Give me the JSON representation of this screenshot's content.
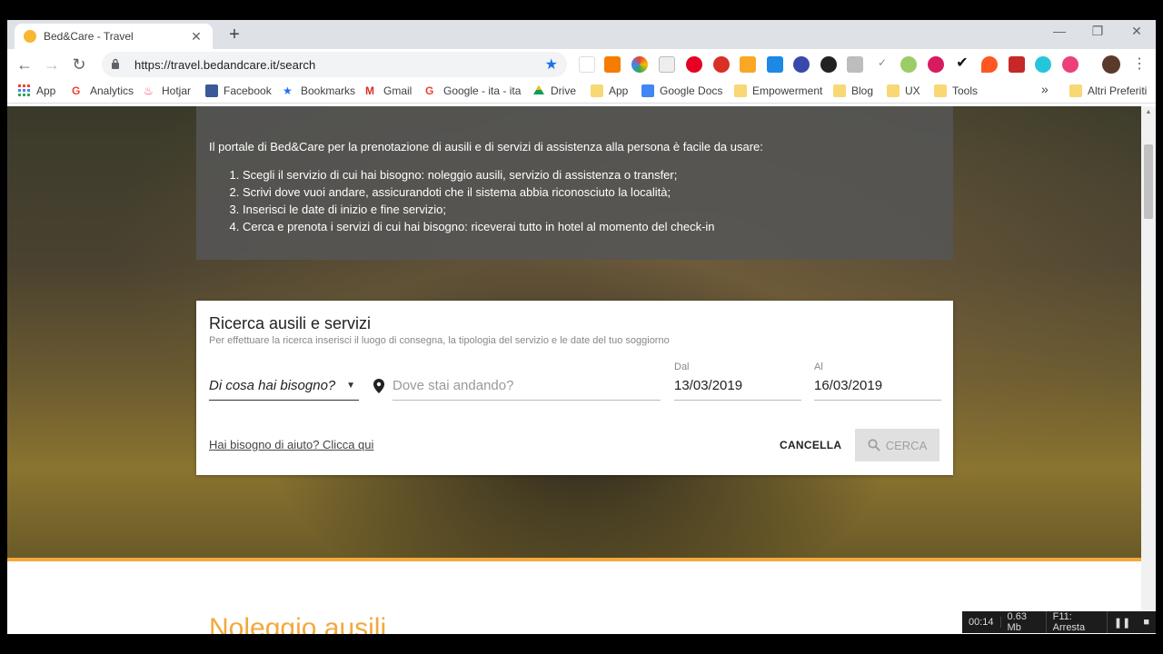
{
  "tab": {
    "title": "Bed&Care - Travel",
    "close": "✕",
    "new": "+"
  },
  "window_controls": {
    "minimize": "—",
    "restore": "❐",
    "close": "✕"
  },
  "toolbar": {
    "back": "←",
    "forward": "→",
    "reload": "↻",
    "url": "https://travel.bedandcare.it/search",
    "menu": "⋮"
  },
  "bookmarks": [
    {
      "label": "App",
      "icon": "apps-grid-icon",
      "color": "#4285f4"
    },
    {
      "label": "Analytics",
      "icon": "google-icon",
      "color": "#ea4335"
    },
    {
      "label": "Hotjar",
      "icon": "hotjar-icon",
      "color": "#fd3a5c"
    },
    {
      "label": "Facebook",
      "icon": "facebook-icon",
      "color": "#3b5998"
    },
    {
      "label": "Bookmarks",
      "icon": "star-icon",
      "color": "#1a73e8"
    },
    {
      "label": "Gmail",
      "icon": "gmail-icon",
      "color": "#d93025"
    },
    {
      "label": "Google - ita - ita",
      "icon": "google-icon",
      "color": "#ea4335"
    },
    {
      "label": "Drive",
      "icon": "drive-icon",
      "color": "#0f9d58"
    },
    {
      "label": "App",
      "icon": "folder-icon",
      "color": "#f8d775"
    },
    {
      "label": "Google Docs",
      "icon": "docs-icon",
      "color": "#4285f4"
    },
    {
      "label": "Empowerment",
      "icon": "folder-icon",
      "color": "#f8d775"
    },
    {
      "label": "Blog",
      "icon": "folder-icon",
      "color": "#f8d775"
    },
    {
      "label": "UX",
      "icon": "folder-icon",
      "color": "#f8d775"
    },
    {
      "label": "Tools",
      "icon": "folder-icon",
      "color": "#f8d775"
    }
  ],
  "bookmarks_more": "»",
  "bookmarks_other": "Altri Preferiti",
  "info": {
    "intro": "Il portale di Bed&Care per la prenotazione di ausili e di servizi di assistenza alla persona è facile da usare:",
    "steps": [
      "Scegli il servizio di cui hai bisogno: noleggio ausili, servizio di assistenza o transfer;",
      "Scrivi dove vuoi andare, assicurandoti che il sistema abbia riconosciuto la località;",
      "Inserisci le date di inizio e fine servizio;",
      "Cerca e prenota i servizi di cui hai bisogno: riceverai tutto in hotel al momento del check-in"
    ]
  },
  "search": {
    "title": "Ricerca ausili e servizi",
    "subtitle": "Per effettuare la ricerca inserisci il luogo di consegna, la tipologia del servizio e le date del tuo soggiorno",
    "need_placeholder": "Di cosa hai bisogno?",
    "where_placeholder": "Dove stai andando?",
    "from_label": "Dal",
    "from_value": "13/03/2019",
    "to_label": "Al",
    "to_value": "16/03/2019",
    "help_link": "Hai bisogno di aiuto? Clicca qui",
    "cancel": "CANCELLA",
    "submit": "CERCA"
  },
  "section_title": "Noleggio ausili",
  "recorder": {
    "time": "00:14",
    "size": "0.63 Mb",
    "action": "F11: Arresta"
  },
  "colors": {
    "accent": "#f3a83b",
    "link_blue": "#1a73e8"
  }
}
